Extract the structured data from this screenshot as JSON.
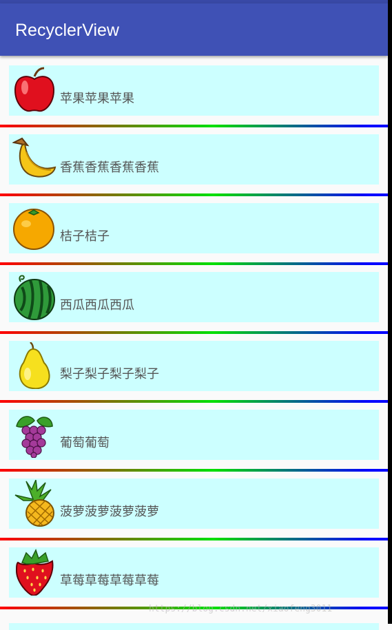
{
  "app_bar": {
    "title": "RecyclerView"
  },
  "fruits": [
    {
      "name": "苹果苹果苹果",
      "icon": "apple-icon"
    },
    {
      "name": "香蕉香蕉香蕉香蕉",
      "icon": "banana-icon"
    },
    {
      "name": "桔子桔子",
      "icon": "orange-icon"
    },
    {
      "name": "西瓜西瓜西瓜",
      "icon": "watermelon-icon"
    },
    {
      "name": "梨子梨子梨子梨子",
      "icon": "pear-icon"
    },
    {
      "name": "葡萄葡萄",
      "icon": "grape-icon"
    },
    {
      "name": "菠萝菠萝菠萝菠萝",
      "icon": "pineapple-icon"
    },
    {
      "name": "草莓草莓草莓草莓",
      "icon": "strawberry-icon"
    }
  ],
  "watermark": "https://blog.csdn.net/xiaofeng3011",
  "colors": {
    "app_bar": "#3f51b5",
    "card_bg": "#ccffff",
    "divider_gradient": [
      "#ff0000",
      "#00e000",
      "#0000ff"
    ]
  }
}
